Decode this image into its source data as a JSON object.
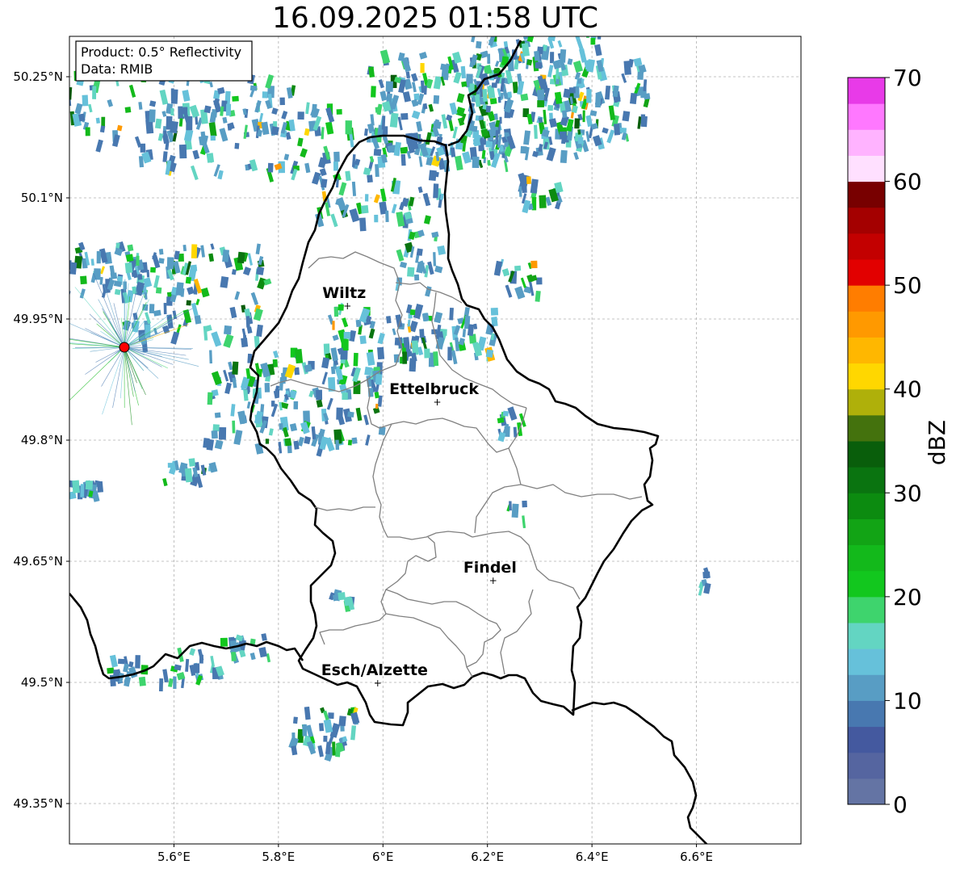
{
  "title": "16.09.2025 01:58 UTC",
  "info": {
    "product": "Product: 0.5° Reflectivity",
    "data": "Data: RMIB"
  },
  "map": {
    "lon_range": [
      5.4,
      6.8
    ],
    "lat_range": [
      49.3,
      50.3
    ],
    "lat_ticks": [
      {
        "value": 50.25,
        "label": "50.25°N"
      },
      {
        "value": 50.1,
        "label": "50.1°N"
      },
      {
        "value": 49.95,
        "label": "49.95°N"
      },
      {
        "value": 49.8,
        "label": "49.8°N"
      },
      {
        "value": 49.65,
        "label": "49.65°N"
      },
      {
        "value": 49.5,
        "label": "49.5°N"
      },
      {
        "value": 49.35,
        "label": "49.35°N"
      }
    ],
    "lon_ticks": [
      {
        "value": 5.6,
        "label": "5.6°E"
      },
      {
        "value": 5.8,
        "label": "5.8°E"
      },
      {
        "value": 6.0,
        "label": "6°E"
      },
      {
        "value": 6.2,
        "label": "6.2°E"
      },
      {
        "value": 6.4,
        "label": "6.4°E"
      },
      {
        "value": 6.6,
        "label": "6.6°E"
      }
    ],
    "grid": true,
    "radar_site": {
      "lon": 5.505,
      "lat": 49.915,
      "color": "#ff0000"
    },
    "cities": [
      {
        "name": "Wiltz",
        "lon": 5.932,
        "lat": 49.966
      },
      {
        "name": "Ettelbruck",
        "lon": 6.104,
        "lat": 49.847
      },
      {
        "name": "Findel",
        "lon": 6.211,
        "lat": 49.626
      },
      {
        "name": "Esch/Alzette",
        "lon": 5.99,
        "lat": 49.499
      }
    ]
  },
  "colorbar": {
    "label": "dBZ",
    "min": 0,
    "max": 70,
    "step": 2.5,
    "ticks": [
      "0",
      "10",
      "20",
      "30",
      "40",
      "50",
      "60",
      "70"
    ],
    "colors": [
      "#6474a4",
      "#5565a0",
      "#44599f",
      "#4878b0",
      "#589dc4",
      "#66c1da",
      "#63d5c2",
      "#3ed46d",
      "#12c71e",
      "#13b91b",
      "#12a415",
      "#0c8b10",
      "#0a7410",
      "#095e0b",
      "#44720d",
      "#afb00a",
      "#ffd700",
      "#ffb700",
      "#ff9900",
      "#ff7d00",
      "#e20000",
      "#c30000",
      "#a40000",
      "#780000",
      "#ffe0ff",
      "#ffb3ff",
      "#ff78ff",
      "#e83ae8"
    ]
  }
}
